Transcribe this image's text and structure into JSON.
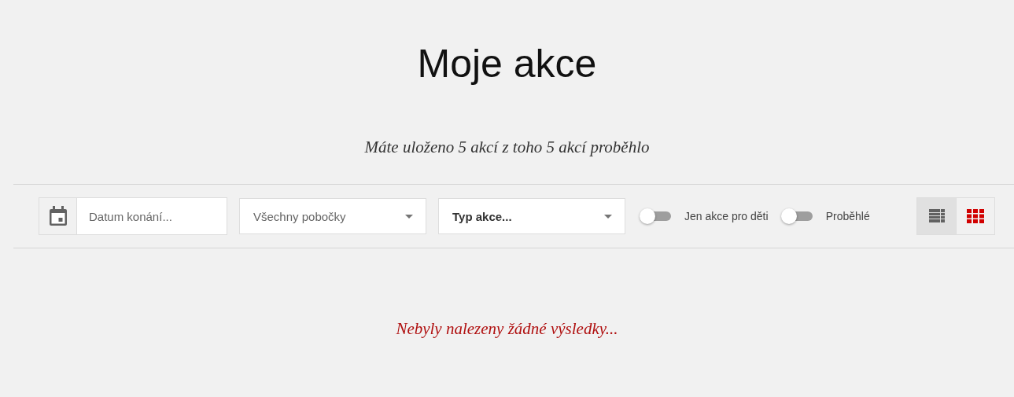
{
  "title": "Moje akce",
  "summary": "Máte uloženo 5 akcí z toho 5 akcí proběhlo",
  "filters": {
    "date": {
      "placeholder": "Datum konání..."
    },
    "selects": [
      {
        "value": "Všechny pobočky",
        "kind": "muted"
      },
      {
        "value": "Typ akce...",
        "kind": "strong"
      }
    ],
    "toggles": [
      {
        "label": "Jen akce pro děti",
        "on": false
      },
      {
        "label": "Proběhlé",
        "on": false
      }
    ],
    "views": [
      {
        "kind": "list",
        "selected": false
      },
      {
        "kind": "grid",
        "selected": true
      }
    ]
  },
  "empty_message": "Nebyly nalezeny žádné výsledky..."
}
